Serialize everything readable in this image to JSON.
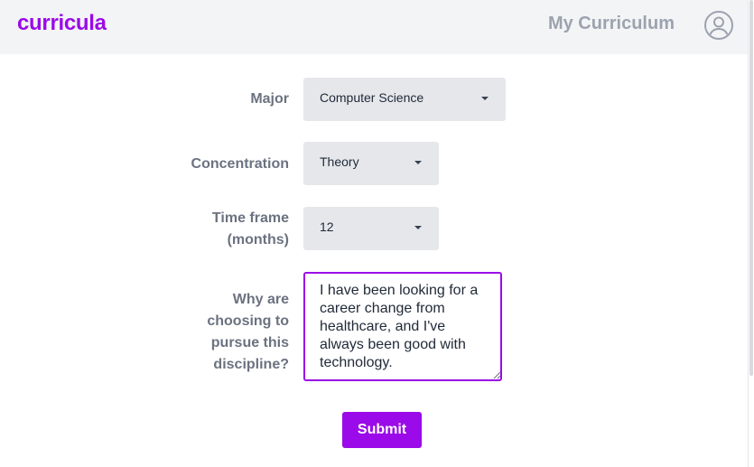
{
  "header": {
    "logo": "curricula",
    "nav_link": "My Curriculum",
    "profile_icon": "user-circle-icon"
  },
  "colors": {
    "accent": "#9b0ae8",
    "header_bg": "#f3f4f6",
    "label": "#6b7280",
    "select_bg": "#e5e7eb"
  },
  "form": {
    "major": {
      "label": "Major",
      "value": "Computer Science"
    },
    "concentration": {
      "label": "Concentration",
      "value": "Theory"
    },
    "timeframe": {
      "label_line1": "Time frame",
      "label_line2": "(months)",
      "value": "12"
    },
    "reason": {
      "label_line1": "Why are",
      "label_line2": "choosing to",
      "label_line3": "pursue this",
      "label_line4": "discipline?",
      "value": "I have been looking for a career change from healthcare, and I've always been good with technology."
    },
    "submit_label": "Submit"
  }
}
